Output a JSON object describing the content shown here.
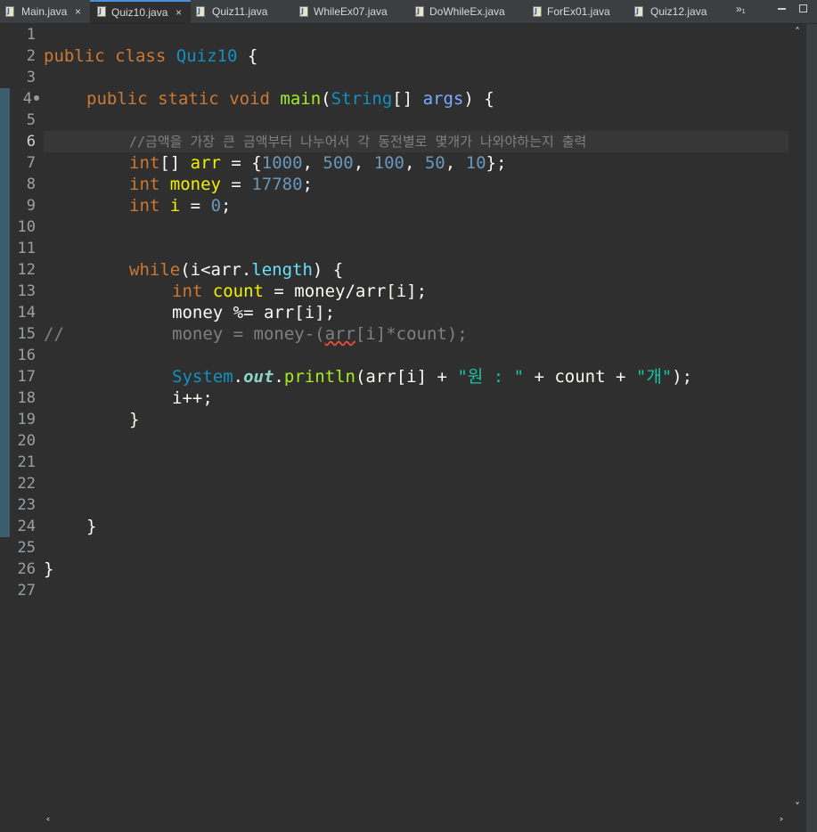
{
  "tabs": [
    {
      "label": "Main.java",
      "active": false
    },
    {
      "label": "Quiz10.java",
      "active": true
    },
    {
      "label": "Quiz11.java",
      "active": false
    },
    {
      "label": "WhileEx07.java",
      "active": false
    },
    {
      "label": "DoWhileEx.java",
      "active": false
    },
    {
      "label": "ForEx01.java",
      "active": false
    },
    {
      "label": "Quiz12.java",
      "active": false
    }
  ],
  "tab_overflow": "»₁",
  "close_glyph": "×",
  "line_numbers": [
    "1",
    "2",
    "3",
    "4",
    "5",
    "6",
    "7",
    "8",
    "9",
    "10",
    "11",
    "12",
    "13",
    "14",
    "15",
    "16",
    "17",
    "18",
    "19",
    "20",
    "21",
    "22",
    "23",
    "24",
    "25",
    "26",
    "27"
  ],
  "current_line": 6,
  "code": {
    "l2": {
      "kw1": "public",
      "kw2": "class",
      "name": "Quiz10",
      "brace": " {"
    },
    "l4": {
      "kw1": "public",
      "kw2": "static",
      "kw3": "void",
      "method": "main",
      "p1": "(",
      "type": "String",
      "p2": "[] ",
      "param": "args",
      "p3": ") {"
    },
    "l6": {
      "comment": "//금액을 가장 큰 금액부터 나누어서 각 동전별로 몇개가 나와야하는지 출력"
    },
    "l7": {
      "type": "int",
      "p1": "[] ",
      "var": "arr",
      "p2": " = {",
      "n1": "1000",
      "c1": ", ",
      "n2": "500",
      "c2": ", ",
      "n3": "100",
      "c3": ", ",
      "n4": "50",
      "c4": ", ",
      "n5": "10",
      "p3": "};"
    },
    "l8": {
      "type": "int",
      "var": "money",
      "p1": " = ",
      "num": "17780",
      "p2": ";"
    },
    "l9": {
      "type": "int",
      "var": "i",
      "p1": " = ",
      "num": "0",
      "p2": ";"
    },
    "l12": {
      "kw": "while",
      "p1": "(i<arr.",
      "field": "length",
      "p2": ") {"
    },
    "l13": {
      "type": "int",
      "var": "count",
      "p1": " = money/arr[i];"
    },
    "l14": {
      "text": "money %= arr[i];"
    },
    "l15": {
      "slashes": "//",
      "pre": "money = money-(",
      "err": "arr",
      "post": "[i]*count);"
    },
    "l17": {
      "cls": "System",
      "dot1": ".",
      "field": "out",
      "dot2": ".",
      "method": "println",
      "p1": "(arr[i] + ",
      "s1": "\"원 : \"",
      "p2": " + count + ",
      "s2": "\"개\"",
      "p3": ");"
    },
    "l18": {
      "text": "i++;"
    },
    "l19": {
      "text": "}"
    },
    "l24": {
      "text": "}"
    },
    "l26": {
      "text": "}"
    }
  },
  "scroll": {
    "up": "˄",
    "down": "˅",
    "left": "˂",
    "right": "˃"
  }
}
